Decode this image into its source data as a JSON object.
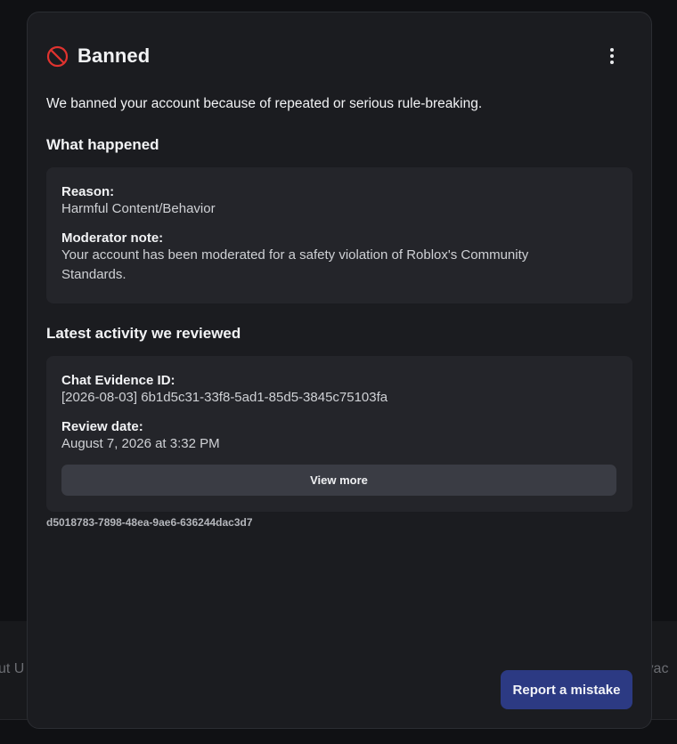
{
  "background": {
    "footer_left": "ut U",
    "footer_right": "ivac"
  },
  "modal": {
    "title": "Banned",
    "title_icon": "ban-icon",
    "menu_icon": "more-vertical-icon",
    "intro": "We banned your account because of repeated or serious rule-breaking.",
    "what_happened": {
      "heading": "What happened",
      "reason_label": "Reason:",
      "reason_value": "Harmful Content/Behavior",
      "note_label": "Moderator note:",
      "note_value": "Your account has been moderated for a safety violation of Roblox's Community Standards."
    },
    "activity": {
      "heading": "Latest activity we reviewed",
      "evidence_label": "Chat Evidence ID:",
      "evidence_value": "[2026-08-03] 6b1d5c31-33f8-5ad1-85d5-3845c75103fa",
      "date_label": "Review date:",
      "date_value": "August 7, 2026 at 3:32 PM",
      "view_more_label": "View more"
    },
    "evidence_hash": "d5018783-7898-48ea-9ae6-636244dac3d7",
    "report_label": "Report a mistake"
  },
  "colors": {
    "ban_icon": "#e0332f",
    "report_button": "#2c3a83",
    "modal_bg": "#1b1c20",
    "card_bg": "#24252a"
  }
}
